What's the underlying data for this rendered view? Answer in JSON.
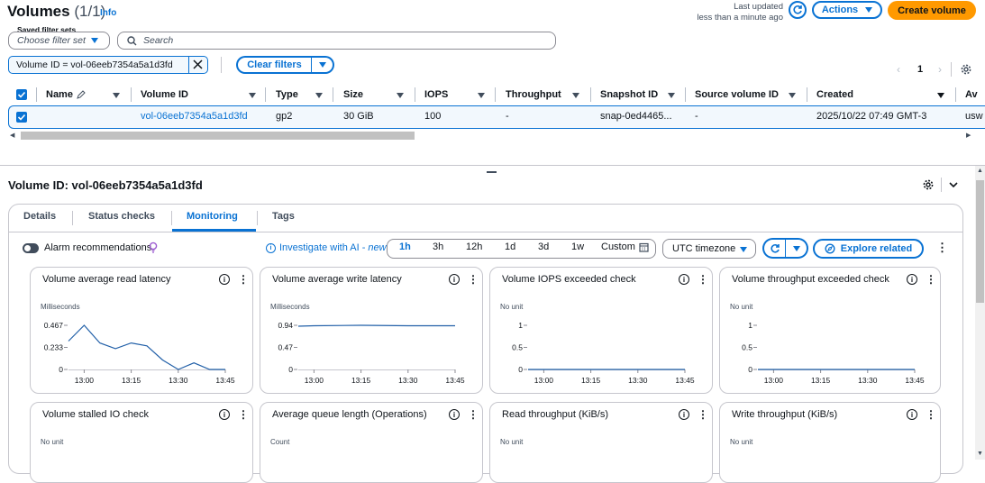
{
  "header": {
    "title": "Volumes",
    "count": "(1/1)",
    "info": "Info",
    "last_updated_label": "Last updated",
    "last_updated_value": "less than a minute ago",
    "actions": "Actions",
    "create": "Create volume"
  },
  "filters": {
    "saved_label": "Saved filter sets",
    "saved_placeholder": "Choose filter set",
    "search_placeholder": "Search",
    "token": "Volume ID = vol-06eeb7354a5a1d3fd",
    "clear": "Clear filters",
    "page": "1"
  },
  "table": {
    "columns": [
      "Name",
      "Volume ID",
      "Type",
      "Size",
      "IOPS",
      "Throughput",
      "Snapshot ID",
      "Source volume ID",
      "Created",
      "Av"
    ],
    "row": {
      "name": "",
      "volume_id": "vol-06eeb7354a5a1d3fd",
      "type": "gp2",
      "size": "30 GiB",
      "iops": "100",
      "throughput": "-",
      "snapshot": "snap-0ed4465...",
      "source": "-",
      "created": "2025/10/22 07:49 GMT-3",
      "az": "usw"
    }
  },
  "detail": {
    "title": "Volume ID: vol-06eeb7354a5a1d3fd",
    "tabs": [
      "Details",
      "Status checks",
      "Monitoring",
      "Tags"
    ],
    "active_tab": "Monitoring"
  },
  "monitoring": {
    "alarm_label": "Alarm recommendations",
    "investigate": "Investigate with AI -",
    "investigate_new": "new",
    "periods": [
      "1h",
      "3h",
      "12h",
      "1d",
      "3d",
      "1w"
    ],
    "custom": "Custom",
    "timezone": "UTC timezone",
    "explore": "Explore related"
  },
  "metrics": [
    {
      "title": "Volume average read latency",
      "unit": "Milliseconds",
      "yticks": [
        "0.467",
        "0.233",
        "0"
      ],
      "xticks": [
        "13:00",
        "13:15",
        "13:30",
        "13:45"
      ]
    },
    {
      "title": "Volume average write latency",
      "unit": "Milliseconds",
      "yticks": [
        "0.94",
        "0.47",
        "0"
      ],
      "xticks": [
        "13:00",
        "13:15",
        "13:30",
        "13:45"
      ]
    },
    {
      "title": "Volume IOPS exceeded check",
      "unit": "No unit",
      "yticks": [
        "1",
        "0.5",
        "0"
      ],
      "xticks": [
        "13:00",
        "13:15",
        "13:30",
        "13:45"
      ]
    },
    {
      "title": "Volume throughput exceeded check",
      "unit": "No unit",
      "yticks": [
        "1",
        "0.5",
        "0"
      ],
      "xticks": [
        "13:00",
        "13:15",
        "13:30",
        "13:45"
      ]
    },
    {
      "title": "Volume stalled IO check",
      "unit": "No unit"
    },
    {
      "title": "Average queue length (Operations)",
      "unit": "Count"
    },
    {
      "title": "Read throughput (KiB/s)",
      "unit": "No unit"
    },
    {
      "title": "Write throughput (KiB/s)",
      "unit": "No unit"
    }
  ],
  "chart_data": [
    {
      "type": "line",
      "title": "Volume average read latency",
      "ylabel": "Milliseconds",
      "ylim": [
        0,
        0.467
      ],
      "x": [
        "12:55",
        "13:00",
        "13:05",
        "13:10",
        "13:15",
        "13:20",
        "13:25",
        "13:30",
        "13:35",
        "13:40",
        "13:45"
      ],
      "values": [
        0.3,
        0.467,
        0.28,
        0.22,
        0.28,
        0.25,
        0.1,
        0.0,
        0.07,
        0.0,
        0.0
      ]
    },
    {
      "type": "line",
      "title": "Volume average write latency",
      "ylabel": "Milliseconds",
      "ylim": [
        0,
        0.94
      ],
      "x": [
        "12:55",
        "13:00",
        "13:15",
        "13:30",
        "13:45"
      ],
      "values": [
        0.92,
        0.93,
        0.94,
        0.93,
        0.93
      ]
    },
    {
      "type": "line",
      "title": "Volume IOPS exceeded check",
      "ylabel": "No unit",
      "ylim": [
        0,
        1
      ],
      "x": [
        "12:55",
        "13:45"
      ],
      "values": [
        0,
        0
      ]
    },
    {
      "type": "line",
      "title": "Volume throughput exceeded check",
      "ylabel": "No unit",
      "ylim": [
        0,
        1
      ],
      "x": [
        "12:55",
        "13:45"
      ],
      "values": [
        0,
        0
      ]
    }
  ],
  "colors": {
    "accent": "#0972d3",
    "primary": "#ff9900",
    "selected_row": "#f2f8fd",
    "line": "#2260a8"
  }
}
